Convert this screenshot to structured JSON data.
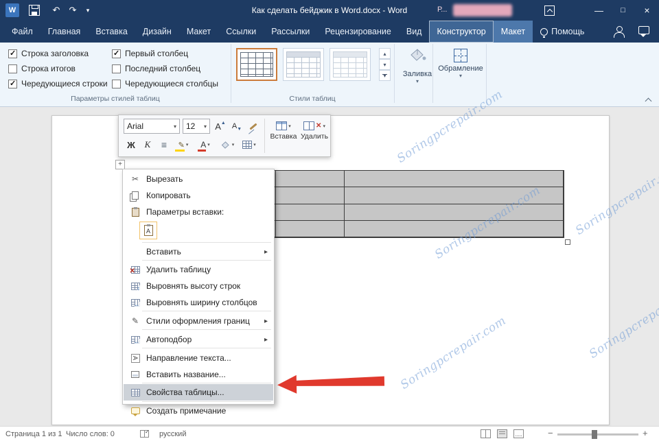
{
  "title_bar": {
    "title": "Как сделать бейджик в Word.docx  -  Word",
    "user_badge": "Р...",
    "icons": [
      "word-app-icon",
      "save-icon",
      "undo-icon",
      "redo-icon",
      "customize-quick-access-icon",
      "ribbon-display-options-icon",
      "minimize-icon",
      "maximize-icon",
      "close-icon"
    ],
    "minimize_glyph": "—",
    "maximize_glyph": "□",
    "close_glyph": "×",
    "undo_glyph": "↶",
    "redo_glyph": "↷",
    "customize_glyph": "▾",
    "app_glyph": "W"
  },
  "tabs": {
    "items": [
      {
        "label": "Файл"
      },
      {
        "label": "Главная"
      },
      {
        "label": "Вставка"
      },
      {
        "label": "Дизайн"
      },
      {
        "label": "Макет"
      },
      {
        "label": "Ссылки"
      },
      {
        "label": "Рассылки"
      },
      {
        "label": "Рецензирование"
      },
      {
        "label": "Вид"
      },
      {
        "label": "Конструктор",
        "active": true
      },
      {
        "label": "Макет",
        "contextual": true
      },
      {
        "label": "Помощь"
      }
    ]
  },
  "ribbon": {
    "style_options": {
      "group_label": "Параметры стилей таблиц",
      "checkboxes": [
        {
          "label": "Строка заголовка",
          "checked": true
        },
        {
          "label": "Строка итогов",
          "checked": false
        },
        {
          "label": "Чередующиеся строки",
          "checked": true
        },
        {
          "label": "Первый столбец",
          "checked": true
        },
        {
          "label": "Последний столбец",
          "checked": false
        },
        {
          "label": "Чередующиеся столбцы",
          "checked": false
        }
      ]
    },
    "table_styles": {
      "group_label": "Стили таблиц",
      "thumbnails": [
        {
          "name": "table-grid-style",
          "selected": true
        },
        {
          "name": "plain-table-style-1",
          "selected": false
        },
        {
          "name": "plain-table-style-2",
          "selected": false
        }
      ],
      "scroll_up_glyph": "▴",
      "scroll_down_glyph": "▾",
      "more_glyph": "▾"
    },
    "shading": {
      "label": "Заливка",
      "dropdown_glyph": "▾"
    },
    "borders": {
      "label": "Обрамление",
      "dropdown_glyph": "▾"
    }
  },
  "mini_toolbar": {
    "font_name": "Arial",
    "font_size": "12",
    "combo_arrow": "▾",
    "grow_font_letter": "А",
    "grow_font_arrow": "▲",
    "shrink_font_letter": "А",
    "shrink_font_arrow": "▼",
    "bold_label": "Ж",
    "italic_label": "К",
    "align_glyph": "≡",
    "font_color_letter": "А",
    "insert_label": "Вставка",
    "delete_label": "Удалить"
  },
  "context_menu": {
    "items": [
      {
        "label": "Вырезать",
        "icon": "cut-icon"
      },
      {
        "label": "Копировать",
        "icon": "copy-icon"
      },
      {
        "label": "Параметры вставки:",
        "icon": "paste-icon"
      },
      {
        "label": "Вставить",
        "submenu": true
      },
      {
        "label": "Удалить таблицу",
        "icon": "delete-table-icon"
      },
      {
        "label": "Выровнять высоту строк",
        "icon": "distribute-rows-icon"
      },
      {
        "label": "Выровнять ширину столбцов",
        "icon": "distribute-columns-icon"
      },
      {
        "label": "Стили оформления границ",
        "icon": "border-styles-icon",
        "submenu": true
      },
      {
        "label": "Автоподбор",
        "icon": "autofit-icon",
        "submenu": true
      },
      {
        "label": "Направление текста...",
        "icon": "text-direction-icon"
      },
      {
        "label": "Вставить название...",
        "icon": "caption-icon"
      },
      {
        "label": "Свойства таблицы...",
        "icon": "table-properties-icon",
        "highlighted": true
      },
      {
        "label": "Создать примечание",
        "icon": "new-comment-icon"
      }
    ],
    "submenu_arrow": "▸",
    "cut_glyph": "✂",
    "pencil_glyph": "✎",
    "paste_option_letter": "A"
  },
  "document": {
    "table": {
      "rows": 4,
      "columns": 3
    },
    "watermark_text": "Soringpcrepair.com"
  },
  "status_bar": {
    "page_label": "Страница 1 из 1",
    "word_count_label": "Число слов: 0",
    "language_label": "русский",
    "zoom_out_glyph": "−",
    "zoom_in_glyph": "+"
  },
  "colors": {
    "title_bar": "#1e3b63",
    "ribbon_bg": "#eef5fb",
    "accent": "#2b579a",
    "arrow_red": "#e0392d",
    "table_fill": "#c6c6c6",
    "menu_highlight": "#cdd2d8",
    "watermark": "#6f9bd6"
  }
}
